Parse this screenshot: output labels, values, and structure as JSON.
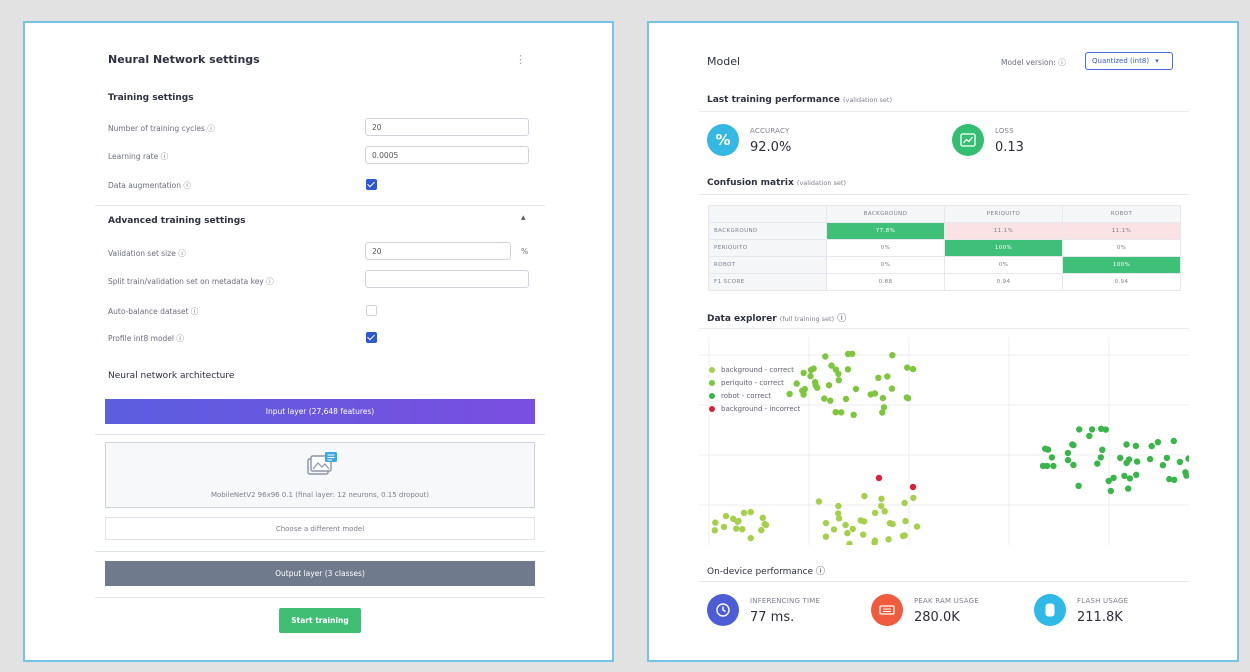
{
  "colors": {
    "panel_border": "#76c3e6",
    "input_layer": "#5b5ee0",
    "output_layer": "#6f7b8c",
    "start_button": "#3fbe74",
    "checkbox": "#2e57d6",
    "accuracy": "#35b8e3",
    "loss": "#34be72",
    "inference": "#4c5dd6",
    "ram": "#ef5b3c",
    "flash": "#2fb9e6",
    "cm_green": "#3fc079",
    "cm_pink": "#fbe3e5",
    "background_correct": "#a6cf4c",
    "periquito_correct": "#7fc63f",
    "robot_correct": "#3ab54a",
    "background_incorrect": "#d8223b"
  },
  "nn": {
    "title": "Neural Network settings",
    "menu_icon": "more-vertical-icon",
    "training_settings_heading": "Training settings",
    "training_cycles_label": "Number of training cycles",
    "training_cycles_value": "20",
    "learning_rate_label": "Learning rate",
    "learning_rate_value": "0.0005",
    "data_augmentation_label": "Data augmentation",
    "data_augmentation_checked": true,
    "advanced_heading": "Advanced training settings",
    "validation_size_label": "Validation set size",
    "validation_size_value": "20",
    "validation_size_unit": "%",
    "split_label": "Split train/validation set on metadata key",
    "split_value": "",
    "auto_balance_label": "Auto-balance dataset",
    "auto_balance_checked": false,
    "profile_int8_label": "Profile int8 model",
    "profile_int8_checked": true,
    "architecture_heading": "Neural network architecture",
    "input_layer": "Input layer (27,648 features)",
    "model_description": "MobileNetV2 96x96 0.1 (final layer: 12 neurons, 0.15 dropout)",
    "choose_model": "Choose a different model",
    "output_layer": "Output layer (3 classes)",
    "start_training": "Start training"
  },
  "model": {
    "title": "Model",
    "version_label": "Model version:",
    "version_selected": "Quantized (int8)",
    "last_training_heading": "Last training performance",
    "last_training_sub": "(validation set)",
    "accuracy_label": "ACCURACY",
    "accuracy_value": "92.0%",
    "loss_label": "LOSS",
    "loss_value": "0.13",
    "confusion_heading": "Confusion matrix",
    "confusion_sub": "(validation set)",
    "confusion": {
      "columns": [
        "BACKGROUND",
        "PERIQUITO",
        "ROBOT"
      ],
      "rows": [
        {
          "label": "BACKGROUND",
          "cells": [
            "77.8%",
            "11.1%",
            "11.1%"
          ]
        },
        {
          "label": "PERIQUITO",
          "cells": [
            "0%",
            "100%",
            "0%"
          ]
        },
        {
          "label": "ROBOT",
          "cells": [
            "0%",
            "0%",
            "100%"
          ]
        }
      ],
      "f1_label": "F1 SCORE",
      "f1": [
        "0.88",
        "0.94",
        "0.94"
      ]
    },
    "explorer_heading": "Data explorer",
    "explorer_sub": "(full training set)",
    "legend": [
      {
        "label": "background - correct",
        "color": "#a6cf4c"
      },
      {
        "label": "periquito - correct",
        "color": "#7fc63f"
      },
      {
        "label": "robot - correct",
        "color": "#3ab54a"
      },
      {
        "label": "background - incorrect",
        "color": "#d8223b"
      }
    ],
    "ondevice_heading": "On-device performance",
    "inferencing_label": "INFERENCING TIME",
    "inferencing_value": "77 ms.",
    "ram_label": "PEAK RAM USAGE",
    "ram_value": "280.0K",
    "flash_label": "FLASH USAGE",
    "flash_value": "211.8K"
  }
}
